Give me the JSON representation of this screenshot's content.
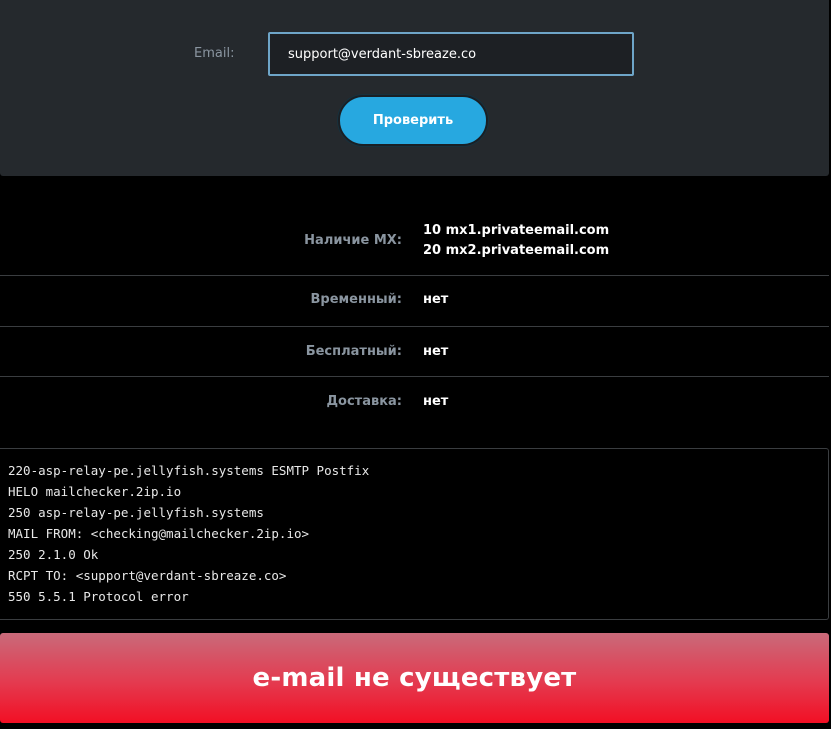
{
  "form": {
    "email_label": "Email:",
    "email_value": "support@verdant-sbreaze.co",
    "check_button_label": "Проверить"
  },
  "results": {
    "mx": {
      "label": "Наличие MX:",
      "records": [
        {
          "priority": "10",
          "host": "mx1.privateemail.com"
        },
        {
          "priority": "20",
          "host": "mx2.privateemail.com"
        }
      ]
    },
    "temporary": {
      "label": "Временный:",
      "value": "нет"
    },
    "free": {
      "label": "Бесплатный:",
      "value": "нет"
    },
    "delivery": {
      "label": "Доставка:",
      "value": "нет"
    }
  },
  "smtp_log": [
    "220-asp-relay-pe.jellyfish.systems ESMTP Postfix",
    "HELO mailchecker.2ip.io",
    "250 asp-relay-pe.jellyfish.systems",
    "MAIL FROM: <checking@mailchecker.2ip.io>",
    "250 2.1.0 Ok",
    "RCPT TO: <support@verdant-sbreaze.co>",
    "550 5.5.1 Protocol error"
  ],
  "verdict": {
    "text": "e-mail не существует"
  },
  "colors": {
    "accent": "#27a8e0",
    "error": "#f20f24"
  }
}
